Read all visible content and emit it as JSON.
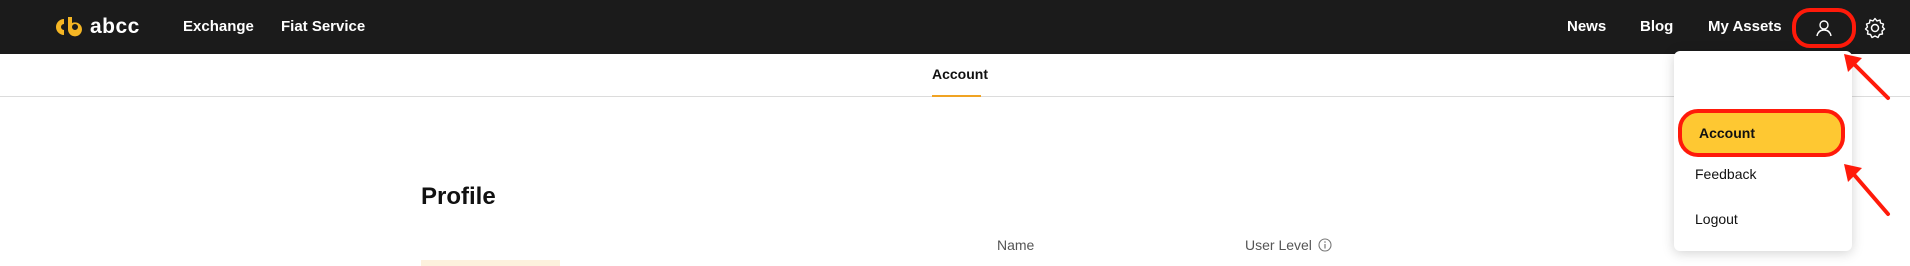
{
  "navbar": {
    "logo_text": "abcc",
    "logo_color": "#f5b624",
    "left_links": [
      "Exchange",
      "Fiat Service"
    ],
    "right_links": [
      "News",
      "Blog",
      "My Assets"
    ],
    "user_icon": "user-icon",
    "settings_icon": "gear-icon"
  },
  "subnav": {
    "active_tab": "Account"
  },
  "page": {
    "title": "Profile",
    "fields": {
      "name_label": "Name",
      "user_level_label": "User Level"
    }
  },
  "dropdown": {
    "items": [
      "Account",
      "Feedback",
      "Logout"
    ],
    "highlight_color": "#fec832"
  },
  "annotations": {
    "color": "#ff1a0a"
  }
}
